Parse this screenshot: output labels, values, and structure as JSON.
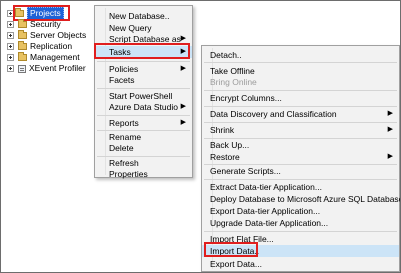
{
  "tree": {
    "projects_label": "Projects",
    "items": [
      {
        "label": "Security",
        "icon": "folder-icon"
      },
      {
        "label": "Server Objects",
        "icon": "folder-icon"
      },
      {
        "label": "Replication",
        "icon": "folder-icon"
      },
      {
        "label": "Management",
        "icon": "folder-icon"
      },
      {
        "label": "XEvent Profiler",
        "icon": "profiler-icon"
      }
    ]
  },
  "context_menu": {
    "new_database": "New Database..",
    "new_query": "New Query",
    "script_database_as": "Script Database as",
    "tasks": "Tasks",
    "policies": "Policies",
    "facets": "Facets",
    "start_powershell": "Start PowerShell",
    "azure_data_studio": "Azure Data Studio",
    "reports": "Reports",
    "rename": "Rename",
    "delete": "Delete",
    "refresh": "Refresh",
    "properties": "Properties"
  },
  "tasks_menu": {
    "detach": "Detach..",
    "take_offline": "Take Offline",
    "bring_online": "Bring Online",
    "encrypt_columns": "Encrypt Columns...",
    "data_discovery": "Data Discovery and Classification",
    "shrink": "Shrink",
    "back_up": "Back Up...",
    "restore": "Restore",
    "generate_scripts": "Generate Scripts...",
    "extract_data_tier": "Extract Data-tier Application...",
    "deploy_azure": "Deploy Database to Microsoft Azure SQL Database..",
    "export_data_tier": "Export Data-tier Application...",
    "upgrade_data_tier": "Upgrade Data-tier Application...",
    "import_flat_file": "Import Flat File...",
    "import_data": "Import Data..",
    "export_data": "Export Data..."
  },
  "arrow_glyph": "▶",
  "colors": {
    "highlight_border": "#e01e1e",
    "selection_blue": "#1e62d6",
    "menu_background": "#f2f2f2",
    "hover_background": "#cce4f7"
  }
}
